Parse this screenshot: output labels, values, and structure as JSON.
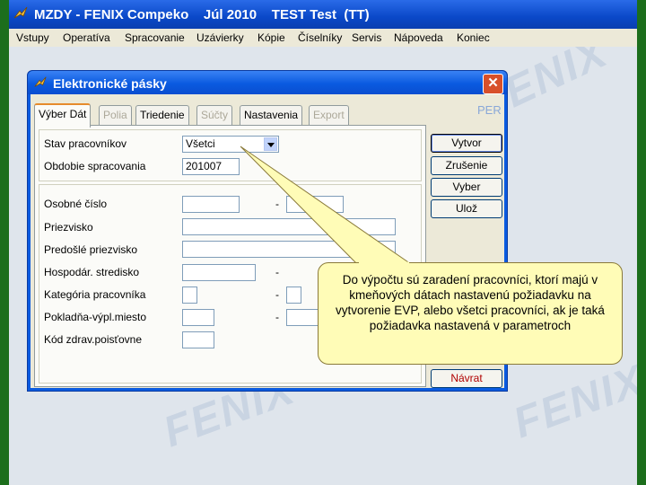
{
  "window": {
    "title": "MZDY - FENIX Compeko    Júl 2010    TEST Test  (TT)"
  },
  "menu": [
    "Vstupy",
    "Operatíva",
    "Spracovanie",
    "Uzávierky",
    "Kópie",
    "Číselníky",
    "Servis",
    "Nápoveda",
    "Koniec"
  ],
  "background": {
    "watermark": "FENIX"
  },
  "dialog": {
    "title": "Elektronické pásky",
    "close": "✕",
    "tabs": [
      "Výber Dát",
      "Polia",
      "Triedenie",
      "Súčty",
      "Nastavenia",
      "Export"
    ],
    "per_label": "PER",
    "fields": {
      "stav_label": "Stav pracovníkov",
      "stav_value": "Všetci",
      "obdobie_label": "Obdobie spracovania",
      "obdobie_value": "201007",
      "osobne_label": "Osobné číslo",
      "priezvisko_label": "Priezvisko",
      "predosle_label": "Predošlé priezvisko",
      "hospodar_label": "Hospodár. stredisko",
      "kategoria_label": "Kategória pracovníka",
      "pokladna_label": "Pokladňa-výpl.miesto",
      "kod_label": "Kód zdrav.poisťovne",
      "dash": "-"
    },
    "buttons": {
      "vytvor": "Vytvor",
      "zrusenie": "Zrušenie",
      "vyber": "Vyber",
      "uloz": "Ulož",
      "navrat": "Návrat"
    }
  },
  "callout": {
    "text": "Do výpočtu sú zaradení  pracovníci, ktorí majú v kmeňových dátach nastavenú požiadavku na vytvorenie EVP, alebo všetci pracovníci, ak je taká požiadavka nastavená v parametroch"
  },
  "colors": {
    "frame": "#1c6e1c",
    "titlebar": "#0a48c8",
    "callout": "#fffcb7",
    "accent_tab": "#e68b2c"
  }
}
